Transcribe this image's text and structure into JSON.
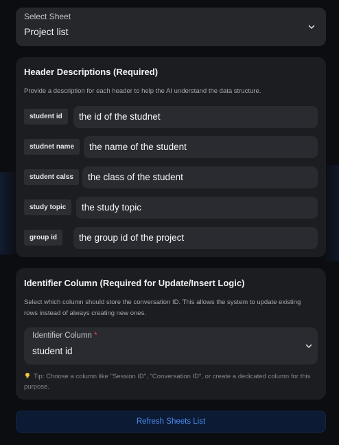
{
  "sheet": {
    "label": "Select Sheet",
    "value": "Project list"
  },
  "headers": {
    "title": "Header Descriptions (Required)",
    "description": "Provide a description for each header to help the AI understand the data structure.",
    "rows": [
      {
        "name": "student id",
        "description": "the id of the studnet"
      },
      {
        "name": "studnet name",
        "description": "the name of the student"
      },
      {
        "name": "student calss",
        "description": "the class of the student"
      },
      {
        "name": "study topic",
        "description": "the study topic"
      },
      {
        "name": "group id",
        "description": "the group id of the project"
      }
    ]
  },
  "identifier": {
    "title": "Identifier Column (Required for Update/Insert Logic)",
    "description": "Select which column should store the conversation ID. This allows the system to update existing rows instead of always creating new ones.",
    "field_label": "Identifier Column",
    "required_mark": "*",
    "value": "student id",
    "tip": "Tip: Choose a column like \"Session ID\", \"Conversation ID\", or create a dedicated column for this purpose."
  },
  "refresh_label": "Refresh Sheets List",
  "colors": {
    "accent": "#4a8cf0",
    "required": "#e5484d",
    "card": "#1c1d21"
  },
  "icons": [
    "chevron-down-icon",
    "lightbulb-icon"
  ]
}
